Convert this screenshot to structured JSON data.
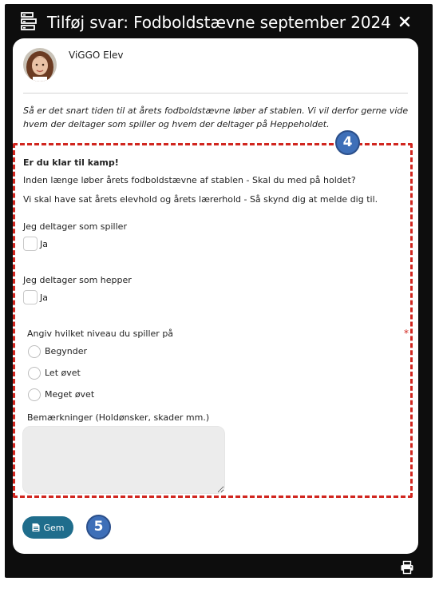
{
  "dialog": {
    "title": "Tilføj svar: Fodboldstævne september 2024"
  },
  "user": {
    "name": "ViGGO Elev"
  },
  "description": "Så er det snart tiden til at årets fodboldstævne løber af stablen. Vi vil derfor gerne vide hvem der deltager som spiller og hvem der deltager på Heppeholdet.",
  "form": {
    "heading": "Er du klar til kamp!",
    "intro_line1": "Inden længe løber årets fodboldstævne af stablen - Skal du med på holdet?",
    "intro_line2": "Vi skal have sat årets elevhold og årets lærerhold - Så skynd dig at melde dig til.",
    "player_question": "Jeg deltager som spiller",
    "player_option": "Ja",
    "fan_question": "Jeg deltager som hepper",
    "fan_option": "Ja",
    "level_question": "Angiv hvilket niveau du spiller på",
    "required_mark": "*",
    "level_options": [
      "Begynder",
      "Let øvet",
      "Meget øvet"
    ],
    "remarks_label": "Bemærkninger (Holdønsker, skader mm.)",
    "remarks_value": ""
  },
  "actions": {
    "save_label": "Gem"
  },
  "annotations": {
    "badge_form": "4",
    "badge_save": "5"
  },
  "colors": {
    "frame": "#0d0d0d",
    "highlight": "#d1261f",
    "badge": "#3e6fb8",
    "save_button": "#1f6d8c"
  },
  "icons": {
    "title": "form-list-icon",
    "close": "close-icon",
    "save": "save-document-icon",
    "print": "printer-icon"
  }
}
